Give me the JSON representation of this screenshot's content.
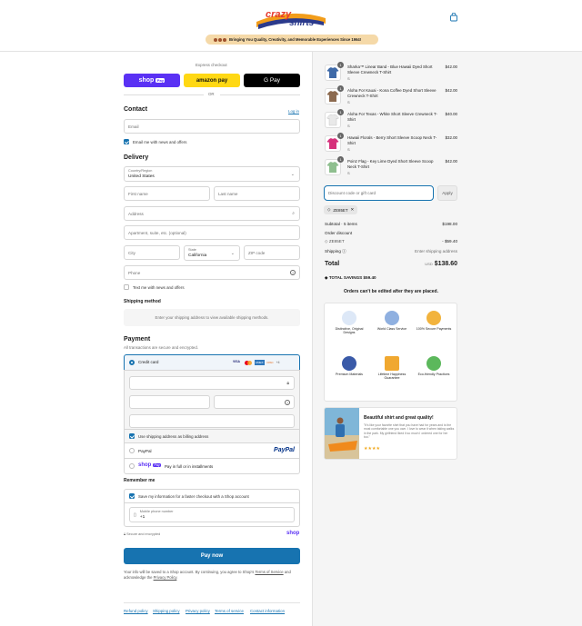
{
  "header": {
    "logo_text": "crazy shirts",
    "banner_text": "Bringing You Quality, Creativity, and Memorable Experiences Since 1964!"
  },
  "express": {
    "title": "Express checkout",
    "or": "OR",
    "shop_pay": "shop",
    "shop_pay_badge": "Pay",
    "amazon": "amazon pay",
    "gpay": "G Pay"
  },
  "contact": {
    "title": "Contact",
    "login": "Log in",
    "email_placeholder": "Email",
    "news_label": "Email me with news and offers"
  },
  "delivery": {
    "title": "Delivery",
    "country_label": "Country/Region",
    "country_value": "United States",
    "first_name": "First name",
    "last_name": "Last name",
    "address": "Address",
    "apartment": "Apartment, suite, etc. (optional)",
    "city": "City",
    "state_label": "State",
    "state_value": "California",
    "zip": "ZIP code",
    "phone": "Phone",
    "text_me": "Text me with news and offers"
  },
  "shipping": {
    "title": "Shipping method",
    "placeholder": "Enter your shipping address to view available shipping methods."
  },
  "payment": {
    "title": "Payment",
    "subtitle": "All transactions are secure and encrypted.",
    "credit_card": "Credit card",
    "cards": [
      "VISA",
      "MC",
      "AMEX",
      "DISC",
      "+4"
    ],
    "billing_same": "Use shipping address as billing address",
    "paypal": "PayPal",
    "paypal_logo": "PayPal",
    "shoppay": "shop",
    "shoppay_badge": "Pay",
    "shoppay_desc": "Pay in full or in installments"
  },
  "remember": {
    "title": "Remember me",
    "save_info": "Save my information for a faster checkout with a Shop account",
    "phone_label": "Mobile phone number",
    "phone_value": "+1",
    "secure": "Secure and encrypted",
    "shop_logo": "shop"
  },
  "pay_now": "Pay now",
  "legal": {
    "text": "Your info will be saved to a Shop account. By continuing, you agree to Shop's ",
    "terms": "Terms of Service",
    "and": " and acknowledge the ",
    "privacy": "Privacy Policy",
    "end": "."
  },
  "footer_links": [
    "Refund policy",
    "Shipping policy",
    "Privacy policy",
    "Terms of service",
    "Contact information"
  ],
  "cart": {
    "items": [
      {
        "name": "Sharka™ Linear Band - Blue Hawaii Dyed Short Sleeve Crewneck T-Shirt",
        "size": "S",
        "price": "$42.00",
        "qty": "1",
        "color": "#3f6aa8"
      },
      {
        "name": "Aloha For Kauai - Kona Coffee Dyed Short Sleeve Crewneck T-Shirt",
        "size": "S",
        "price": "$42.00",
        "qty": "1",
        "color": "#8c6a4f"
      },
      {
        "name": "Aloha For Texas - White Short Sleeve Crewneck T-Shirt",
        "size": "S",
        "price": "$40.00",
        "qty": "1",
        "color": "#e9e9e9"
      },
      {
        "name": "Hawaii Florals - Berry Short Sleeve Scoop Neck T-Shirt",
        "size": "S",
        "price": "$32.00",
        "qty": "1",
        "color": "#d6327c"
      },
      {
        "name": "Poinz Flag - Key Lime Dyed Short Sleeve Scoop Neck T-Shirt",
        "size": "S",
        "price": "$42.00",
        "qty": "1",
        "color": "#8fbf8f"
      }
    ],
    "discount_placeholder": "Discount code or gift card",
    "apply": "Apply",
    "code_chip": "ZE85ET",
    "subtotal_label": "Subtotal · 5 items",
    "subtotal": "$198.00",
    "order_discount": "Order discount",
    "discount_code": "ZE85ET",
    "discount_value": "- $59.40",
    "shipping_label": "Shipping",
    "shipping_value": "Enter shipping address",
    "total_label": "Total",
    "currency": "USD",
    "total": "$138.60",
    "savings": "TOTAL SAVINGS $59.40",
    "no_edit": "Orders can't be edited after they are placed."
  },
  "features": [
    "Distinctive, Original Designs",
    "World Class Service",
    "100% Secure Payments",
    "Premium Materials",
    "Lifetime Happiness Guarantee",
    "Eco-friendly Practices"
  ],
  "review": {
    "title": "Beautiful shirt and great quality!",
    "text": "\"It's like your favorite shirt that you have had for years and is the most comfortable one you own. I love to wear it when taking walks in the park. My girlfriend liked it so much I ordered one for her too.\"",
    "stars": "★★★★"
  },
  "colors": {
    "accent": "#1773b0",
    "shop_purple": "#5a31f4",
    "amazon": "#ffd814"
  }
}
